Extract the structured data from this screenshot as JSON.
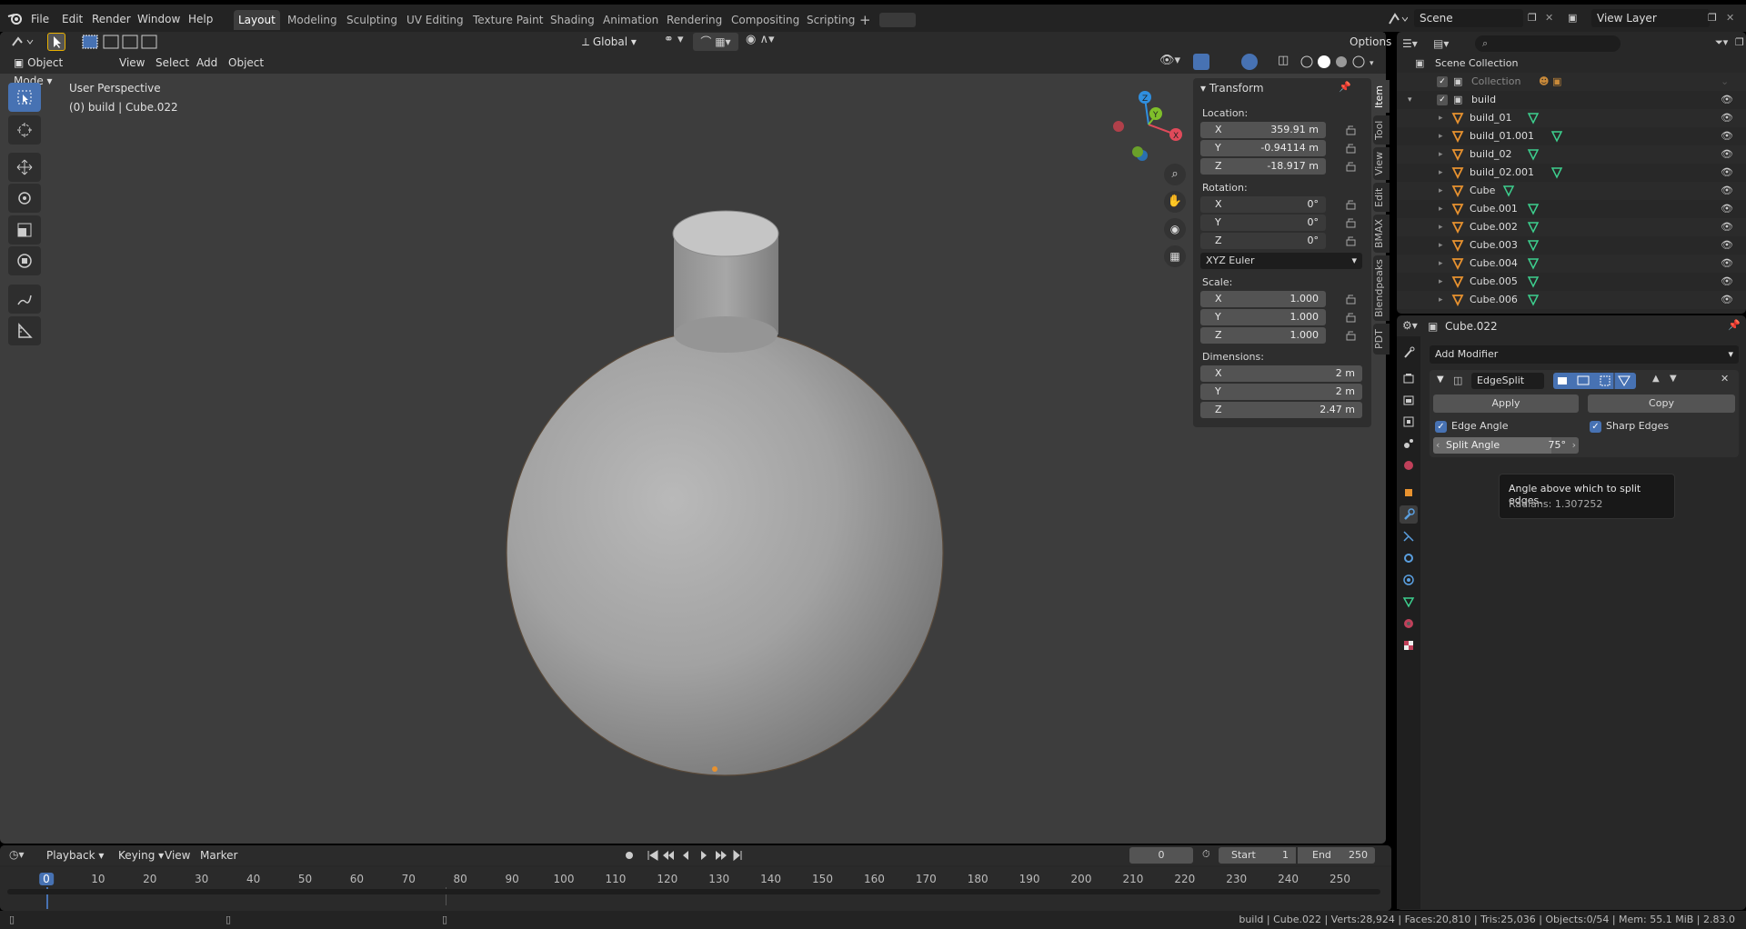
{
  "topbar": {
    "menus": [
      "File",
      "Edit",
      "Render",
      "Window",
      "Help"
    ],
    "workspaces": [
      "Layout",
      "Modeling",
      "Sculpting",
      "UV Editing",
      "Texture Paint",
      "Shading",
      "Animation",
      "Rendering",
      "Compositing",
      "Scripting"
    ],
    "active_workspace": "Layout",
    "scene": "Scene",
    "view_layer": "View Layer"
  },
  "viewport": {
    "mode": "Object Mode",
    "menus": [
      "View",
      "Select",
      "Add",
      "Object"
    ],
    "orientation": "Global",
    "options": "Options",
    "overlay_title": "User Perspective",
    "overlay_subtitle": "(0) build | Cube.022",
    "gizmo": {
      "x": "X",
      "y": "Y",
      "z": "Z"
    }
  },
  "npanel": {
    "title": "Transform",
    "location_label": "Location:",
    "location": [
      {
        "axis": "X",
        "value": "359.91 m"
      },
      {
        "axis": "Y",
        "value": "-0.94114 m"
      },
      {
        "axis": "Z",
        "value": "-18.917 m"
      }
    ],
    "rotation_label": "Rotation:",
    "rotation": [
      {
        "axis": "X",
        "value": "0°"
      },
      {
        "axis": "Y",
        "value": "0°"
      },
      {
        "axis": "Z",
        "value": "0°"
      }
    ],
    "rotation_mode": "XYZ Euler",
    "scale_label": "Scale:",
    "scale": [
      {
        "axis": "X",
        "value": "1.000"
      },
      {
        "axis": "Y",
        "value": "1.000"
      },
      {
        "axis": "Z",
        "value": "1.000"
      }
    ],
    "dimensions_label": "Dimensions:",
    "dimensions": [
      {
        "axis": "X",
        "value": "2 m"
      },
      {
        "axis": "Y",
        "value": "2 m"
      },
      {
        "axis": "Z",
        "value": "2.47 m"
      }
    ],
    "tabs": [
      "Item",
      "Tool",
      "View",
      "Edit",
      "BMAX",
      "Blendpeaks",
      "PDT"
    ]
  },
  "outliner": {
    "root": "Scene Collection",
    "rows": [
      {
        "name": "Collection",
        "kind": "collection"
      },
      {
        "name": "build",
        "kind": "collection"
      },
      {
        "name": "build_01",
        "kind": "object"
      },
      {
        "name": "build_01.001",
        "kind": "object"
      },
      {
        "name": "build_02",
        "kind": "object"
      },
      {
        "name": "build_02.001",
        "kind": "object"
      },
      {
        "name": "Cube",
        "kind": "object"
      },
      {
        "name": "Cube.001",
        "kind": "object"
      },
      {
        "name": "Cube.002",
        "kind": "object"
      },
      {
        "name": "Cube.003",
        "kind": "object"
      },
      {
        "name": "Cube.004",
        "kind": "object"
      },
      {
        "name": "Cube.005",
        "kind": "object"
      },
      {
        "name": "Cube.006",
        "kind": "object"
      }
    ]
  },
  "properties": {
    "object_name": "Cube.022",
    "add_modifier": "Add Modifier",
    "modifier_name": "EdgeSplit",
    "apply": "Apply",
    "copy": "Copy",
    "edge_angle": "Edge Angle",
    "sharp_edges": "Sharp Edges",
    "split_angle_label": "Split Angle",
    "split_angle_value": "75°",
    "tooltip_line1": "Angle above which to split edges.",
    "tooltip_line2": "Radians: 1.307252"
  },
  "timeline": {
    "menus": [
      "Playback",
      "Keying",
      "View",
      "Marker"
    ],
    "current_frame": "0",
    "start_label": "Start",
    "start": "1",
    "end_label": "End",
    "end": "250",
    "ticks": [
      "0",
      "10",
      "20",
      "30",
      "40",
      "50",
      "60",
      "70",
      "80",
      "90",
      "100",
      "110",
      "120",
      "130",
      "140",
      "150",
      "160",
      "170",
      "180",
      "190",
      "200",
      "210",
      "220",
      "230",
      "240",
      "250"
    ]
  },
  "status": {
    "text": "build | Cube.022 | Verts:28,924 | Faces:20,810 | Tris:25,036 | Objects:0/54 | Mem: 55.1 MiB | 2.83.0"
  },
  "colors": {
    "accent": "#4772b3",
    "object": "#e8922f",
    "mesh": "#3dcf8e",
    "x": "#e04a5a",
    "y": "#7fbf2a",
    "z": "#2f8fe0"
  }
}
